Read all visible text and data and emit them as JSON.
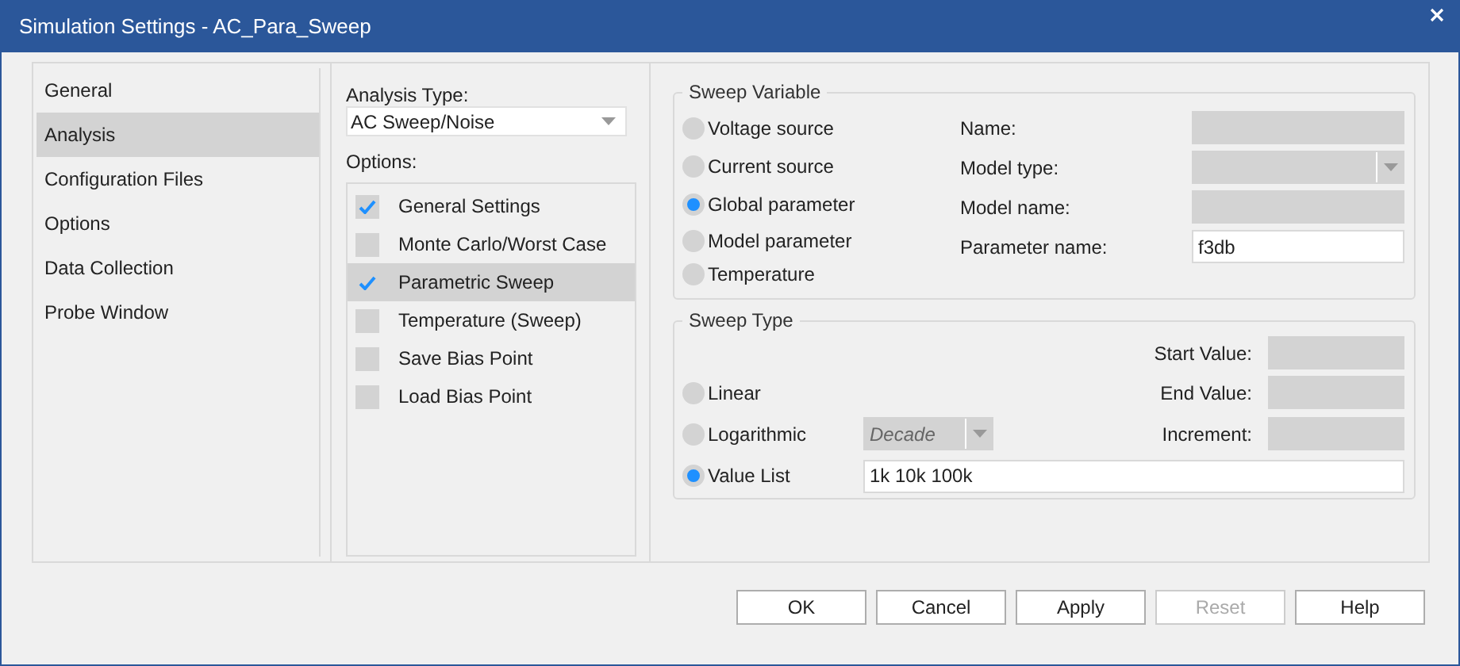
{
  "window": {
    "title": "Simulation Settings - AC_Para_Sweep"
  },
  "sidebar": {
    "items": [
      {
        "label": "General",
        "selected": false
      },
      {
        "label": "Analysis",
        "selected": true
      },
      {
        "label": "Configuration Files",
        "selected": false
      },
      {
        "label": "Options",
        "selected": false
      },
      {
        "label": "Data Collection",
        "selected": false
      },
      {
        "label": "Probe Window",
        "selected": false
      }
    ]
  },
  "analysis_type": {
    "label": "Analysis Type:",
    "value": "AC Sweep/Noise"
  },
  "options": {
    "label": "Options:",
    "items": [
      {
        "label": "General Settings",
        "checked": true,
        "selected": false
      },
      {
        "label": "Monte Carlo/Worst Case",
        "checked": false,
        "selected": false
      },
      {
        "label": "Parametric Sweep",
        "checked": true,
        "selected": true
      },
      {
        "label": "Temperature (Sweep)",
        "checked": false,
        "selected": false
      },
      {
        "label": "Save Bias Point",
        "checked": false,
        "selected": false
      },
      {
        "label": "Load Bias Point",
        "checked": false,
        "selected": false
      }
    ]
  },
  "sweep_variable": {
    "title": "Sweep Variable",
    "sources": [
      {
        "label": "Voltage source",
        "selected": false
      },
      {
        "label": "Current source",
        "selected": false
      },
      {
        "label": "Global parameter",
        "selected": true
      },
      {
        "label": "Model parameter",
        "selected": false
      },
      {
        "label": "Temperature",
        "selected": false
      }
    ],
    "fields": [
      {
        "label": "Name:",
        "kind": "text",
        "disabled": true
      },
      {
        "label": "Model type:",
        "kind": "dropdown",
        "disabled": true
      },
      {
        "label": "Model name:",
        "kind": "text",
        "disabled": true
      },
      {
        "label": "Parameter name:",
        "kind": "text",
        "value": "f3db",
        "disabled": false
      }
    ]
  },
  "sweep_type": {
    "title": "Sweep Type",
    "types": [
      {
        "label": "Linear",
        "selected": false
      },
      {
        "label": "Logarithmic",
        "selected": false
      },
      {
        "label": "Value List",
        "selected": true
      }
    ],
    "log_scale": {
      "value": "Decade",
      "disabled": true
    },
    "fields": [
      {
        "label": "Start Value:",
        "disabled": true
      },
      {
        "label": "End Value:",
        "disabled": true
      },
      {
        "label": "Increment:",
        "disabled": true
      }
    ],
    "value_list": "1k 10k 100k"
  },
  "buttons": [
    {
      "label": "OK",
      "disabled": false
    },
    {
      "label": "Cancel",
      "disabled": false
    },
    {
      "label": "Apply",
      "disabled": false
    },
    {
      "label": "Reset",
      "disabled": true
    },
    {
      "label": "Help",
      "disabled": false
    }
  ]
}
